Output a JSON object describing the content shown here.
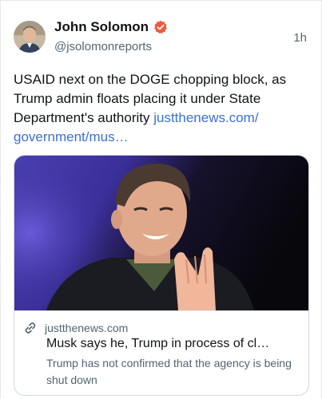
{
  "author": {
    "name": "John Solomon",
    "handle": "@jsolomonreports",
    "verified_badge_color": "#f0593a"
  },
  "timestamp": "1h",
  "tweet": {
    "text": "USAID next on the DOGE chopping block, as Trump admin floats placing it under State Department's authority ",
    "link_text": "justthenews.com/ government/mus…",
    "link_color": "#3a6fd8"
  },
  "link_card": {
    "domain": "justthenews.com",
    "title": "Musk says he, Trump in process of cl…",
    "description": "Trump has not confirmed that the agency is being shut down"
  },
  "icons": {
    "verified": "verified-badge-icon",
    "link": "link-icon"
  }
}
